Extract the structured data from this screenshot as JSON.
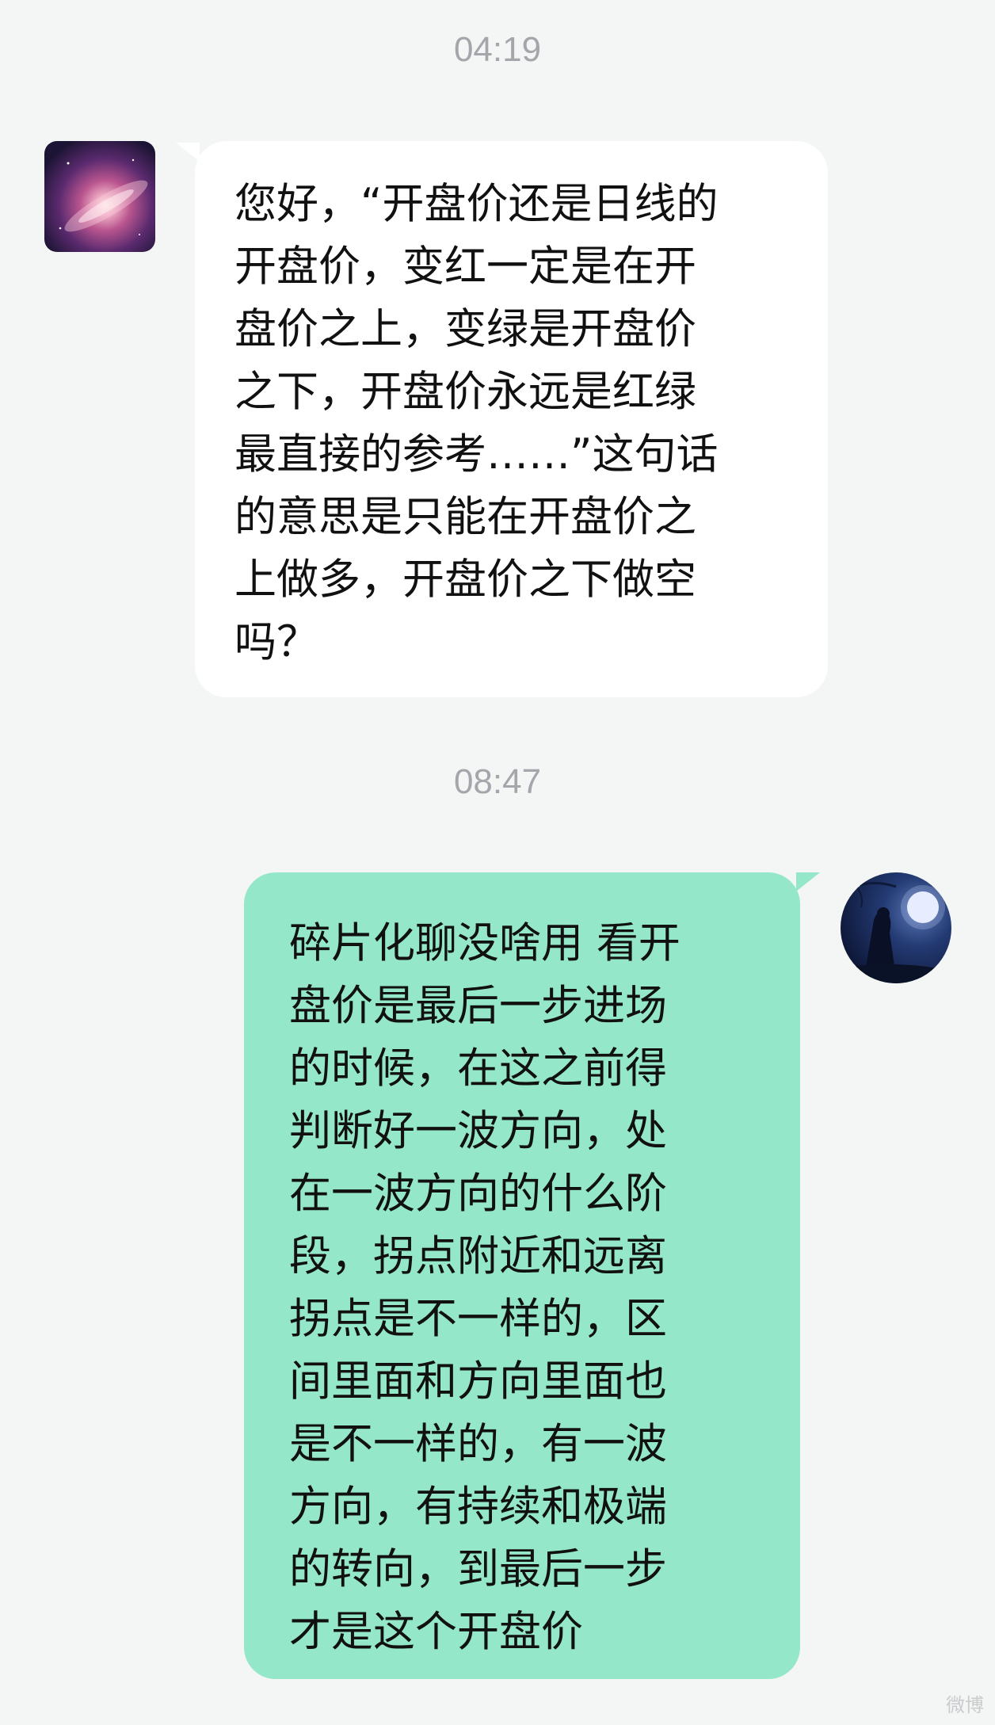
{
  "chat": {
    "timestamps": [
      "04:19",
      "08:47"
    ],
    "incoming_message": {
      "lines": [
        "您好，“开盘价还是日线的",
        "开盘价，变红一定是在开",
        "盘价之上，变绿是开盘价",
        "之下，开盘价永远是红绿",
        "最直接的参考……”这句话",
        "的意思是只能在开盘价之",
        "上做多，开盘价之下做空",
        "吗？"
      ]
    },
    "outgoing_message": {
      "lines": [
        "碎片化聊没啥用 看开",
        "盘价是最后一步进场",
        "的时候，在这之前得",
        "判断好一波方向，处",
        "在一波方向的什么阶",
        "段，拐点附近和远离",
        "拐点是不一样的，区",
        "间里面和方向里面也",
        "是不一样的，有一波",
        "方向，有持续和极端",
        "的转向，到最后一步",
        "才是这个开盘价"
      ]
    },
    "watermark": "微博"
  },
  "colors": {
    "background": "#f4f5f5",
    "incoming_bubble": "#ffffff",
    "outgoing_bubble": "#95e7c9",
    "timestamp_text": "#a3a6aa"
  },
  "icons": {
    "left_avatar": "galaxy-avatar-icon",
    "right_avatar": "moonlit-figure-avatar-icon"
  }
}
